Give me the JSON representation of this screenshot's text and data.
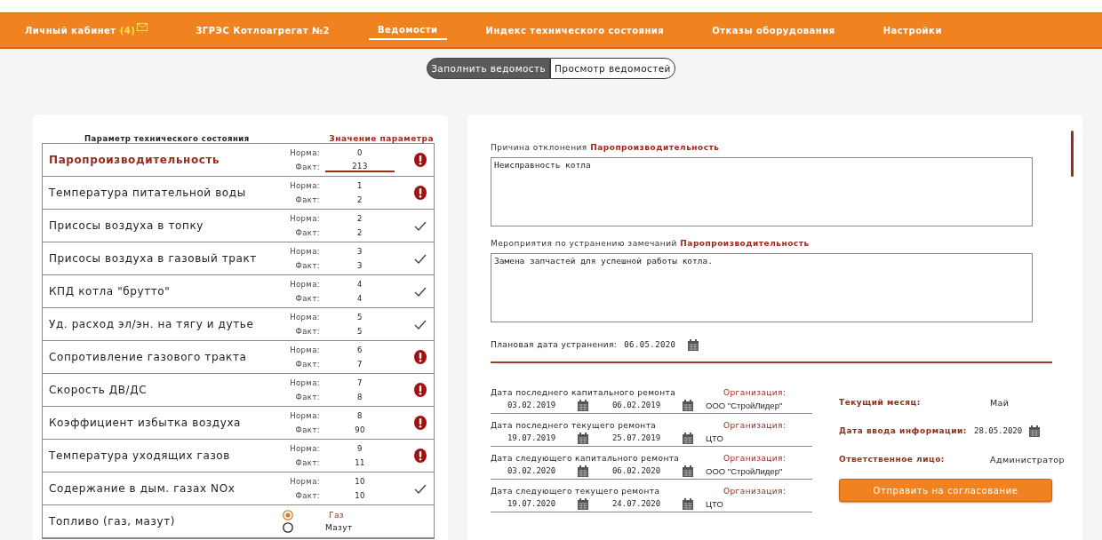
{
  "nav": [
    {
      "label": "Личный кабинет",
      "count": "(4)",
      "selected": false
    },
    {
      "label": "ЗГРЭС Котлоагрегат №2",
      "selected": false
    },
    {
      "label": "Ведомости",
      "selected": true
    },
    {
      "label": "Индекс технического состояния",
      "selected": false
    },
    {
      "label": "Отказы оборудования",
      "selected": false
    },
    {
      "label": "Настройки",
      "selected": false
    }
  ],
  "toggle": [
    {
      "label": "Заполнить ведомость",
      "selected": true
    },
    {
      "label": "Просмотр ведомостей",
      "selected": false
    }
  ],
  "params": {
    "header": {
      "name": "Параметр технического состояния",
      "value": "Значение параметра"
    },
    "rows": [
      {
        "name": "Паропроизводительность",
        "norm_label": "Норма:",
        "norm": "0",
        "fact_label": "Факт:",
        "fact": "213",
        "alert": true,
        "selected": true
      },
      {
        "name": "Температура питательной воды",
        "norm_label": "Норма:",
        "norm": "1",
        "fact_label": "Факт:",
        "fact": "2",
        "alert": true,
        "selected": false
      },
      {
        "name": "Присосы воздуха в топку",
        "norm_label": "Норма:",
        "norm": "2",
        "fact_label": "Факт:",
        "fact": "2",
        "alert": false,
        "selected": false
      },
      {
        "name": "Присосы воздуха в газовый тракт",
        "norm_label": "Норма:",
        "norm": "3",
        "fact_label": "Факт:",
        "fact": "3",
        "alert": false,
        "selected": false
      },
      {
        "name": "КПД котла \"брутто\"",
        "norm_label": "Норма:",
        "norm": "4",
        "fact_label": "Факт:",
        "fact": "4",
        "alert": false,
        "selected": false
      },
      {
        "name": "Уд. расход эл/эн. на тягу и дутье",
        "norm_label": "Норма:",
        "norm": "5",
        "fact_label": "Факт:",
        "fact": "5",
        "alert": false,
        "selected": false
      },
      {
        "name": "Сопротивление газового тракта",
        "norm_label": "Норма:",
        "norm": "6",
        "fact_label": "Факт:",
        "fact": "7",
        "alert": true,
        "selected": false
      },
      {
        "name": "Скорость ДВ/ДС",
        "norm_label": "Норма:",
        "norm": "7",
        "fact_label": "Факт:",
        "fact": "8",
        "alert": true,
        "selected": false
      },
      {
        "name": "Коэффициент избытка воздуха",
        "norm_label": "Норма:",
        "norm": "8",
        "fact_label": "Факт:",
        "fact": "90",
        "alert": true,
        "selected": false
      },
      {
        "name": "Температура уходящих газов",
        "norm_label": "Норма:",
        "norm": "9",
        "fact_label": "Факт:",
        "fact": "11",
        "alert": true,
        "selected": false
      },
      {
        "name": "Содержание в дым. газах NOx",
        "norm_label": "Норма:",
        "norm": "10",
        "fact_label": "Факт:",
        "fact": "10",
        "alert": false,
        "selected": false
      }
    ],
    "fuel": {
      "name": "Топливо (газ, мазут)",
      "options": [
        {
          "label": "Газ",
          "selected": true
        },
        {
          "label": "Мазут",
          "selected": false
        }
      ]
    }
  },
  "reason": {
    "label": "Причина отклонения",
    "param": "Паропроизводительность",
    "value": "Неисправность котла"
  },
  "measures": {
    "label": "Мероприятия по устранению замечаний",
    "param": "Паропроизводительность",
    "value": "Замена запчастей для успешной работы котла."
  },
  "planned": {
    "label": "Плановая дата устранения:",
    "value": "06.05.2020"
  },
  "repairs": [
    {
      "label": "Дата последнего капитального ремонта",
      "org_label": "Организация:",
      "date_from": "03.02.2019",
      "date_to": "06.02.2019",
      "org": "ООО \"СтройЛидер\""
    },
    {
      "label": "Дата последнего текущего ремонта",
      "org_label": "Организация:",
      "date_from": "19.07.2019",
      "date_to": "25.07.2019",
      "org": "ЦТО"
    },
    {
      "label": "Дата следующего капитального ремонта",
      "org_label": "Организация:",
      "date_from": "03.02.2020",
      "date_to": "06.02.2020",
      "org": "ООО \"СтройЛидер\""
    },
    {
      "label": "Дата следующего текущего ремонта",
      "org_label": "Организация:",
      "date_from": "19.07.2020",
      "date_to": "24.07.2020",
      "org": "ЦТО"
    }
  ],
  "info": [
    {
      "label": "Текущий месяц:",
      "value": "Май",
      "kind": "text"
    },
    {
      "label": "Дата ввода информации:",
      "value": "28.05.2020",
      "kind": "date"
    },
    {
      "label": "Ответственное лицо:",
      "value": "Администратор",
      "kind": "text"
    }
  ],
  "submit": "Отправить на согласование"
}
